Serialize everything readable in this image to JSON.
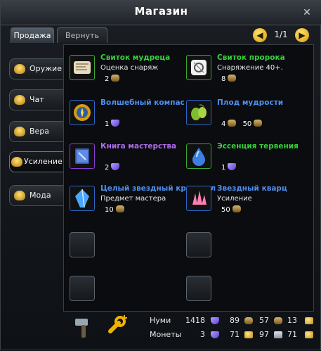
{
  "window": {
    "title": "Магазин"
  },
  "tabs": [
    {
      "label": "Продажа",
      "active": true
    },
    {
      "label": "Вернуть",
      "active": false
    }
  ],
  "pager": {
    "text": "1/1"
  },
  "categories": [
    {
      "label": "Оружие",
      "selected": false
    },
    {
      "label": "Чат",
      "selected": false
    },
    {
      "label": "Вера",
      "selected": false
    },
    {
      "label": "Усиление",
      "selected": true
    },
    {
      "label": "Мода",
      "selected": false
    }
  ],
  "items": [
    {
      "name": "Свиток мудреца",
      "rarity": "green",
      "desc": "Оценка снаряж",
      "price": "2",
      "currency": "bag",
      "icon": "scroll-map-icon"
    },
    {
      "name": "Свиток пророка",
      "rarity": "green",
      "desc": "Снаряжение 40+.",
      "price": "8",
      "currency": "bag",
      "icon": "scroll-glyph-icon"
    },
    {
      "name": "Волшебный компас",
      "rarity": "blue",
      "desc": "",
      "price": "1",
      "currency": "gem",
      "icon": "compass-icon"
    },
    {
      "name": "Плод мудрости",
      "rarity": "blue",
      "desc": "",
      "price": "4",
      "price2": "50",
      "currency": "bag",
      "icon": "fruit-icon"
    },
    {
      "name": "Книга мастерства",
      "rarity": "purple",
      "desc": "",
      "price": "2",
      "currency": "gem",
      "icon": "book-icon"
    },
    {
      "name": "Эссенция тервения",
      "rarity": "green",
      "desc": "",
      "price": "1",
      "currency": "gem",
      "icon": "essence-drop-icon"
    },
    {
      "name": "Целый звездный кристалл",
      "rarity": "blue",
      "desc": "Предмет мастера",
      "price": "10",
      "currency": "bag",
      "icon": "blue-crystal-icon"
    },
    {
      "name": "Звездный кварц",
      "rarity": "blue",
      "desc": "Усиление",
      "price": "50",
      "currency": "bag",
      "icon": "pink-quartz-icon"
    }
  ],
  "footer": {
    "numi_label": "Нуми",
    "numi_values": [
      "1418",
      "89",
      "57",
      "13"
    ],
    "coins_label": "Монеты",
    "coins_values": [
      "3",
      "71",
      "97",
      "71"
    ]
  }
}
